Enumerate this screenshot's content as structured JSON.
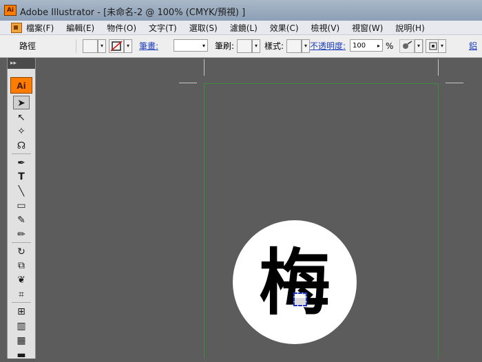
{
  "window": {
    "app_logo": "Ai",
    "title": "Adobe Illustrator - [未命名-2 @ 100% (CMYK/預視) ]"
  },
  "menu": {
    "items": [
      "檔案(F)",
      "編輯(E)",
      "物件(O)",
      "文字(T)",
      "選取(S)",
      "濾鏡(L)",
      "效果(C)",
      "檢視(V)",
      "視窗(W)",
      "說明(H)"
    ]
  },
  "control_bar": {
    "mode_label": "路徑",
    "stroke_label": "筆畫:",
    "brush_label": "筆刷:",
    "style_label": "樣式:",
    "opacity_label": "不透明度:",
    "opacity_value": "100",
    "percent_symbol": "%",
    "overflow_label": "鋁"
  },
  "toolbox": {
    "grip": "▸▸",
    "logo": "Ai"
  },
  "artwork": {
    "glyph": "梅"
  }
}
